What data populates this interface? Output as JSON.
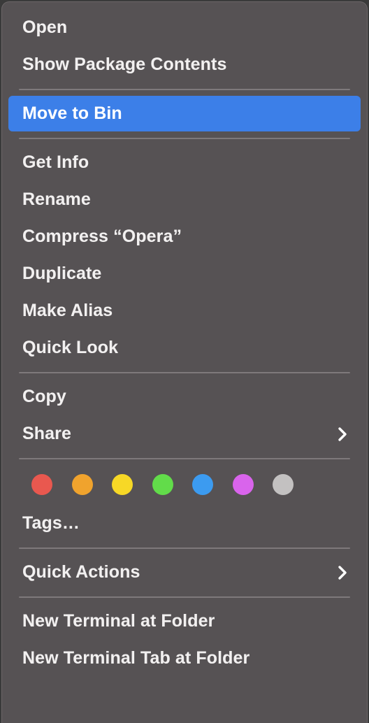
{
  "menu": {
    "kind": "finder-context-menu",
    "background_color": "#565254",
    "border_color": "#6b6668",
    "text_color": "#f2f0f0",
    "separator_color": "#7e797b",
    "highlight_color": "#3c7fe8",
    "sections": [
      {
        "name": "open-section",
        "items": [
          {
            "label": "Open",
            "selected": false,
            "submenu": false
          },
          {
            "label": "Show Package Contents",
            "selected": false,
            "submenu": false
          }
        ]
      },
      {
        "name": "trash-section",
        "items": [
          {
            "label": "Move to Bin",
            "selected": true,
            "submenu": false
          }
        ]
      },
      {
        "name": "file-operations-section",
        "items": [
          {
            "label": "Get Info",
            "selected": false,
            "submenu": false
          },
          {
            "label": "Rename",
            "selected": false,
            "submenu": false
          },
          {
            "label": "Compress “Opera”",
            "selected": false,
            "submenu": false
          },
          {
            "label": "Duplicate",
            "selected": false,
            "submenu": false
          },
          {
            "label": "Make Alias",
            "selected": false,
            "submenu": false
          },
          {
            "label": "Quick Look",
            "selected": false,
            "submenu": false
          }
        ]
      },
      {
        "name": "copy-share-section",
        "items": [
          {
            "label": "Copy",
            "selected": false,
            "submenu": false
          },
          {
            "label": "Share",
            "selected": false,
            "submenu": true
          }
        ]
      },
      {
        "name": "tags-section",
        "tag_colors": [
          {
            "name": "red",
            "hex": "#e9584f"
          },
          {
            "name": "orange",
            "hex": "#f0a32d"
          },
          {
            "name": "yellow",
            "hex": "#f7d826"
          },
          {
            "name": "green",
            "hex": "#62dc4a"
          },
          {
            "name": "blue",
            "hex": "#3c9bf0"
          },
          {
            "name": "purple",
            "hex": "#d964ec"
          },
          {
            "name": "gray",
            "hex": "#c3c1c1"
          }
        ],
        "items": [
          {
            "label": "Tags…",
            "selected": false,
            "submenu": false
          }
        ]
      },
      {
        "name": "quick-actions-section",
        "items": [
          {
            "label": "Quick Actions",
            "selected": false,
            "submenu": true
          }
        ]
      },
      {
        "name": "terminal-section",
        "items": [
          {
            "label": "New Terminal at Folder",
            "selected": false,
            "submenu": false
          },
          {
            "label": "New Terminal Tab at Folder",
            "selected": false,
            "submenu": false
          }
        ]
      }
    ]
  }
}
